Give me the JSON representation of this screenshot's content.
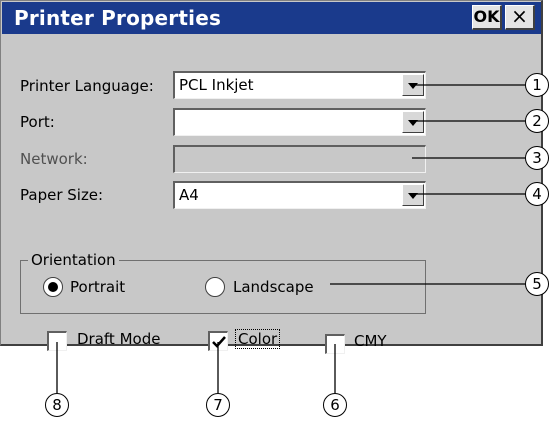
{
  "dialog": {
    "title": "Printer Properties",
    "ok_label": "OK",
    "close_label": "×"
  },
  "fields": {
    "printer_language": {
      "label": "Printer Language:",
      "value": "PCL Inkjet"
    },
    "port": {
      "label": "Port:",
      "value": ""
    },
    "network": {
      "label": "Network:",
      "value": ""
    },
    "paper_size": {
      "label": "Paper Size:",
      "value": "A4"
    }
  },
  "orientation": {
    "legend": "Orientation",
    "options": [
      {
        "label": "Portrait",
        "selected": true
      },
      {
        "label": "Landscape",
        "selected": false
      }
    ]
  },
  "checkboxes": [
    {
      "label": "Draft Mode",
      "checked": false
    },
    {
      "label": "Color",
      "checked": true
    },
    {
      "label": "CMY",
      "checked": false
    }
  ],
  "callouts": [
    "1",
    "2",
    "3",
    "4",
    "5",
    "6",
    "7",
    "8"
  ],
  "colors": {
    "titlebar": "#1a3a8c",
    "dialog_bg": "#c8c8c8"
  }
}
